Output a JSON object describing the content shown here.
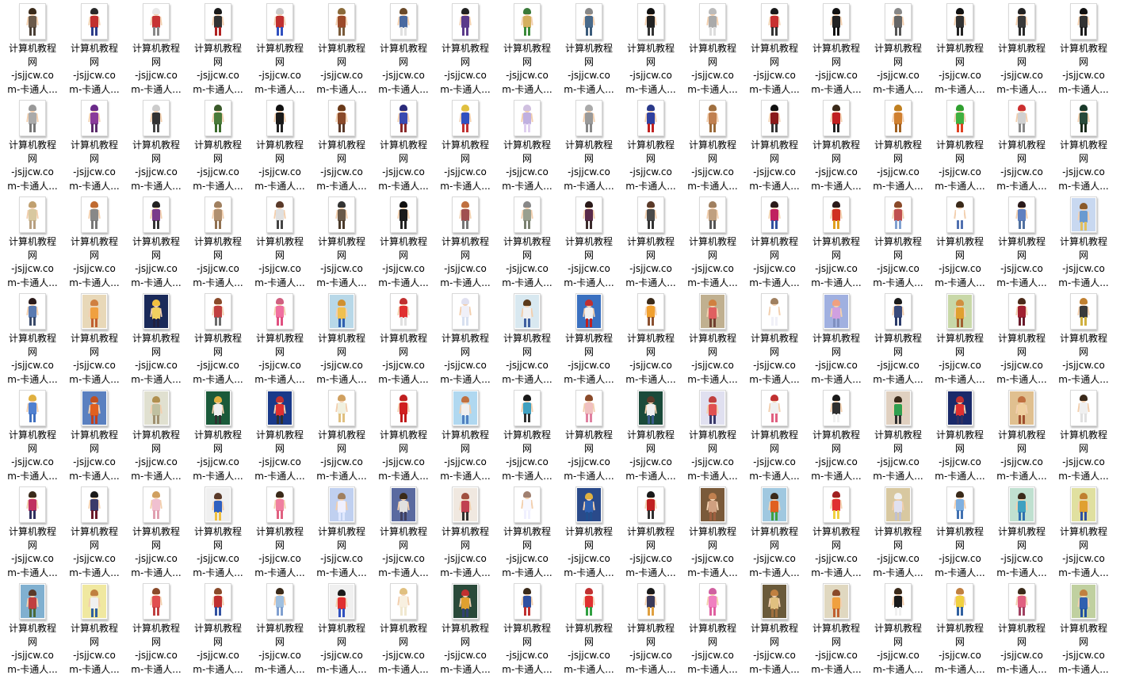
{
  "window": {
    "view": "Large icons",
    "content": "folder of cartoon character thumbnails"
  },
  "files": {
    "label_lines": [
      "计算机教程",
      "网",
      "-jsjjcw.co",
      "m-卡通人..."
    ],
    "columns": 18,
    "rows": 7,
    "items": [
      {
        "style": "char",
        "hair": "#3a2a1a",
        "top": "#6b5a4a",
        "bottom": "#4a3f35"
      },
      {
        "style": "char",
        "hair": "#2a2a2a",
        "top": "#c23030",
        "bottom": "#2d3d8a"
      },
      {
        "style": "char",
        "hair": "#e8e8e8",
        "top": "#c73434",
        "bottom": "#888888"
      },
      {
        "style": "char",
        "hair": "#1a1a1a",
        "top": "#333333",
        "bottom": "#b02020"
      },
      {
        "style": "char",
        "hair": "#cccccc",
        "top": "#c03030",
        "bottom": "#3050c0"
      },
      {
        "style": "char",
        "hair": "#8a6a3a",
        "top": "#9b4a2a",
        "bottom": "#7a5a3a"
      },
      {
        "style": "char",
        "hair": "#6a4a2a",
        "top": "#4a6aa0",
        "bottom": "#e0e0e0"
      },
      {
        "style": "char",
        "hair": "#222222",
        "top": "#5a3a8a",
        "bottom": "#5a3a8a"
      },
      {
        "style": "char",
        "hair": "#3a7a3a",
        "top": "#d4b060",
        "bottom": "#3a8a3a"
      },
      {
        "style": "char",
        "hair": "#888888",
        "top": "#4a6a8a",
        "bottom": "#3a5a7a"
      },
      {
        "style": "char",
        "hair": "#111111",
        "top": "#222222",
        "bottom": "#333333"
      },
      {
        "style": "char",
        "hair": "#bbbbbb",
        "top": "#aaaaaa",
        "bottom": "#dddddd"
      },
      {
        "style": "char",
        "hair": "#1a1a1a",
        "top": "#c83030",
        "bottom": "#333333"
      },
      {
        "style": "char",
        "hair": "#111111",
        "top": "#222222",
        "bottom": "#111111"
      },
      {
        "style": "char",
        "hair": "#888888",
        "top": "#666666",
        "bottom": "#555555"
      },
      {
        "style": "char",
        "hair": "#111111",
        "top": "#333333",
        "bottom": "#222222"
      },
      {
        "style": "char",
        "hair": "#222222",
        "top": "#3a3a3a",
        "bottom": "#2a2a2a"
      },
      {
        "style": "char",
        "hair": "#111111",
        "top": "#333333",
        "bottom": "#1a1a1a"
      },
      {
        "style": "char",
        "hair": "#999999",
        "top": "#aaaaaa",
        "bottom": "#777777"
      },
      {
        "style": "char",
        "hair": "#6a2a8a",
        "top": "#8a3a9a",
        "bottom": "#5a2a6a"
      },
      {
        "style": "char",
        "hair": "#cccccc",
        "top": "#333333",
        "bottom": "#444444"
      },
      {
        "style": "char",
        "hair": "#3a5a2a",
        "top": "#4a7a3a",
        "bottom": "#3a6a2a"
      },
      {
        "style": "char",
        "hair": "#111111",
        "top": "#1a1a1a",
        "bottom": "#222222"
      },
      {
        "style": "char",
        "hair": "#6a3a1a",
        "top": "#8a4a2a",
        "bottom": "#5a3a2a"
      },
      {
        "style": "char",
        "hair": "#2a2a7a",
        "top": "#3a4ab0",
        "bottom": "#8a2a2a"
      },
      {
        "style": "char",
        "hair": "#e0c040",
        "top": "#3050c0",
        "bottom": "#c03030"
      },
      {
        "style": "char",
        "hair": "#d0c0e0",
        "top": "#c0b0e0",
        "bottom": "#e0d0f0"
      },
      {
        "style": "char",
        "hair": "#aaaaaa",
        "top": "#999999",
        "bottom": "#888888"
      },
      {
        "style": "char",
        "hair": "#2a3a8a",
        "top": "#3040a0",
        "bottom": "#c02020"
      },
      {
        "style": "char",
        "hair": "#a07040",
        "top": "#c08050",
        "bottom": "#9a6a3a"
      },
      {
        "style": "char",
        "hair": "#111111",
        "top": "#8a1a1a",
        "bottom": "#333333"
      },
      {
        "style": "char",
        "hair": "#3a2a1a",
        "top": "#c02020",
        "bottom": "#222222"
      },
      {
        "style": "char",
        "hair": "#c08020",
        "top": "#d08030",
        "bottom": "#a06020"
      },
      {
        "style": "char",
        "hair": "#30a030",
        "top": "#40b040",
        "bottom": "#e04020"
      },
      {
        "style": "char",
        "hair": "#cc3030",
        "top": "#d0d0d0",
        "bottom": "#888888"
      },
      {
        "style": "char",
        "hair": "#1a3a2a",
        "top": "#2a4a3a",
        "bottom": "#1a2a1a"
      },
      {
        "style": "char",
        "hair": "#c0a070",
        "top": "#d8c8a0",
        "bottom": "#b8a080"
      },
      {
        "style": "char",
        "hair": "#c06a30",
        "top": "#888888",
        "bottom": "#777777"
      },
      {
        "style": "char",
        "hair": "#222222",
        "top": "#7a3a8a",
        "bottom": "#333333"
      },
      {
        "style": "char",
        "hair": "#a08060",
        "top": "#b09070",
        "bottom": "#907050"
      },
      {
        "style": "char",
        "hair": "#5a3a2a",
        "top": "#e0e0e0",
        "bottom": "#444444"
      },
      {
        "style": "char",
        "hair": "#333333",
        "top": "#6a5a4a",
        "bottom": "#4a3a2a"
      },
      {
        "style": "char",
        "hair": "#111111",
        "top": "#1a1a1a",
        "bottom": "#222222"
      },
      {
        "style": "char",
        "hair": "#c07040",
        "top": "#a05050",
        "bottom": "#777777"
      },
      {
        "style": "char",
        "hair": "#888888",
        "top": "#9aa090",
        "bottom": "#7a8070"
      },
      {
        "style": "char",
        "hair": "#2a1a1a",
        "top": "#5a2a4a",
        "bottom": "#3a2a2a"
      },
      {
        "style": "char",
        "hair": "#5a3a2a",
        "top": "#4a4a4a",
        "bottom": "#333333"
      },
      {
        "style": "char",
        "hair": "#a08060",
        "top": "#c0a080",
        "bottom": "#555555"
      },
      {
        "style": "char",
        "hair": "#2a1a1a",
        "top": "#c02060",
        "bottom": "#3050a0"
      },
      {
        "style": "char",
        "hair": "#2a1a1a",
        "top": "#d03020",
        "bottom": "#e0a020"
      },
      {
        "style": "char",
        "hair": "#8a4a2a",
        "top": "#c05050",
        "bottom": "#80a0d0"
      },
      {
        "style": "char",
        "hair": "#3a2a1a",
        "top": "#ffffff",
        "bottom": "#5070b0"
      },
      {
        "style": "char",
        "hair": "#2a1a1a",
        "top": "#6080c0",
        "bottom": "#5070a0"
      },
      {
        "style": "scene",
        "bg": "#c8d8f0",
        "hair": "#8a5a2a",
        "top": "#6a9ad0",
        "bottom": "#e0c060"
      },
      {
        "style": "char",
        "hair": "#2a1a1a",
        "top": "#5a7ab0",
        "bottom": "#3a4a6a"
      },
      {
        "style": "scene",
        "bg": "#e8d8b8",
        "hair": "#d08040",
        "top": "#f0a040",
        "bottom": "#c06030"
      },
      {
        "style": "scene",
        "bg": "#1a2a5a",
        "hair": "#f0c040",
        "top": "#f0d060",
        "bottom": "#202040"
      },
      {
        "style": "char",
        "hair": "#8a4a2a",
        "top": "#c04040",
        "bottom": "#6a6a6a"
      },
      {
        "style": "char",
        "hair": "#d06080",
        "top": "#f070a0",
        "bottom": "#e05080"
      },
      {
        "style": "scene",
        "bg": "#b8d8e8",
        "hair": "#d09030",
        "top": "#f0c050",
        "bottom": "#3060b0"
      },
      {
        "style": "char",
        "hair": "#c03030",
        "top": "#e03030",
        "bottom": "#e0e0e0"
      },
      {
        "style": "char",
        "hair": "#e0e0f0",
        "top": "#f0f0f8",
        "bottom": "#d8e0f0"
      },
      {
        "style": "scene",
        "bg": "#d8e8f0",
        "hair": "#5a3a1a",
        "top": "#f0f0f0",
        "bottom": "#4060a0"
      },
      {
        "style": "scene",
        "bg": "#3a70c0",
        "hair": "#c03030",
        "top": "#f0f0f0",
        "bottom": "#c02020"
      },
      {
        "style": "char",
        "hair": "#3a2a1a",
        "top": "#f0a030",
        "bottom": "#8a5030"
      },
      {
        "style": "scene",
        "bg": "#c0b090",
        "hair": "#d08040",
        "top": "#e06060",
        "bottom": "#704030"
      },
      {
        "style": "char",
        "hair": "#a08060",
        "top": "#ffffff",
        "bottom": "#f0f0f8"
      },
      {
        "style": "scene",
        "bg": "#a0b0e0",
        "hair": "#f0a080",
        "top": "#d0a0e0",
        "bottom": "#8090c0"
      },
      {
        "style": "char",
        "hair": "#1a1a1a",
        "top": "#3a4a7a",
        "bottom": "#2a3a6a"
      },
      {
        "style": "scene",
        "bg": "#c8d8a8",
        "hair": "#d09040",
        "top": "#e0a030",
        "bottom": "#a06030"
      },
      {
        "style": "char",
        "hair": "#4a2a1a",
        "top": "#a02030",
        "bottom": "#6a1a2a"
      },
      {
        "style": "char",
        "hair": "#c08030",
        "top": "#3a3a3a",
        "bottom": "#d0b040"
      },
      {
        "style": "char",
        "hair": "#e0b040",
        "top": "#5080d0",
        "bottom": "#4070c0"
      },
      {
        "style": "scene",
        "bg": "#5a80c0",
        "hair": "#c05020",
        "top": "#e06020",
        "bottom": "#c04020"
      },
      {
        "style": "scene",
        "bg": "#e0e0d0",
        "hair": "#b09050",
        "top": "#c0c0a0",
        "bottom": "#a09070"
      },
      {
        "style": "scene",
        "bg": "#1a5a3a",
        "hair": "#e0b040",
        "top": "#f0f0f0",
        "bottom": "#303030"
      },
      {
        "style": "scene",
        "bg": "#1a3a8a",
        "hair": "#c03030",
        "top": "#e03030",
        "bottom": "#303030"
      },
      {
        "style": "char",
        "hair": "#d0a060",
        "top": "#f0f0e0",
        "bottom": "#e0c080"
      },
      {
        "style": "char",
        "hair": "#c02020",
        "top": "#d02020",
        "bottom": "#c01818"
      },
      {
        "style": "scene",
        "bg": "#b0d8f0",
        "hair": "#c07040",
        "top": "#f0f0f0",
        "bottom": "#5080c0"
      },
      {
        "style": "char",
        "hair": "#1a1a1a",
        "top": "#40a0c0",
        "bottom": "#303030"
      },
      {
        "style": "char",
        "hair": "#8a4a2a",
        "top": "#f0c0c0",
        "bottom": "#e080a0"
      },
      {
        "style": "scene",
        "bg": "#1a4a3a",
        "hair": "#5a3a2a",
        "top": "#f0f0f0",
        "bottom": "#3a5a8a"
      },
      {
        "style": "scene",
        "bg": "#e0e0f0",
        "hair": "#c04040",
        "top": "#e05050",
        "bottom": "#3a3a6a"
      },
      {
        "style": "char",
        "hair": "#c03030",
        "top": "#f0f0f0",
        "bottom": "#e06080"
      },
      {
        "style": "char",
        "hair": "#1a1a1a",
        "top": "#303030",
        "bottom": "#f0f0f0"
      },
      {
        "style": "scene",
        "bg": "#e0d0c0",
        "hair": "#3a2a1a",
        "top": "#30a050",
        "bottom": "#303030"
      },
      {
        "style": "scene",
        "bg": "#1a2a6a",
        "hair": "#c03030",
        "top": "#e03030",
        "bottom": "#303060"
      },
      {
        "style": "scene",
        "bg": "#e0c090",
        "hair": "#c07040",
        "top": "#f0d0a0",
        "bottom": "#a05030"
      },
      {
        "style": "char",
        "hair": "#3a2a1a",
        "top": "#f0f0f0",
        "bottom": "#e0e0e0"
      },
      {
        "style": "char",
        "hair": "#3a2a1a",
        "top": "#c03060",
        "bottom": "#303060"
      },
      {
        "style": "char",
        "hair": "#1a1a1a",
        "top": "#3a3a6a",
        "bottom": "#6a1a2a"
      },
      {
        "style": "char",
        "hair": "#d0a060",
        "top": "#f0c0d0",
        "bottom": "#e0a0b0"
      },
      {
        "style": "scene",
        "bg": "#f0f0f0",
        "hair": "#5a3a2a",
        "top": "#3060c0",
        "bottom": "#f0c040"
      },
      {
        "style": "char",
        "hair": "#3a2a1a",
        "top": "#f080a0",
        "bottom": "#e06080"
      },
      {
        "style": "scene",
        "bg": "#c0d0f0",
        "hair": "#a08060",
        "top": "#f0f0ff",
        "bottom": "#e0e8ff"
      },
      {
        "style": "scene",
        "bg": "#5a6aa0",
        "hair": "#3a2a1a",
        "top": "#e0e0e0",
        "bottom": "#404060"
      },
      {
        "style": "scene",
        "bg": "#f0e8e0",
        "hair": "#a05040",
        "top": "#c04050",
        "bottom": "#303030"
      },
      {
        "style": "char",
        "hair": "#a08070",
        "top": "#f8f8ff",
        "bottom": "#f0f0ff"
      },
      {
        "style": "scene",
        "bg": "#2a4a8a",
        "hair": "#e0b040",
        "top": "#3060b0",
        "bottom": "#205090"
      },
      {
        "style": "char",
        "hair": "#1a1a1a",
        "top": "#c02020",
        "bottom": "#303030"
      },
      {
        "style": "scene",
        "bg": "#7a5a3a",
        "hair": "#c08050",
        "top": "#d0a080",
        "bottom": "#a06040"
      },
      {
        "style": "scene",
        "bg": "#a0c8e0",
        "hair": "#3a2a1a",
        "top": "#e06020",
        "bottom": "#40a040"
      },
      {
        "style": "char",
        "hair": "#a02020",
        "top": "#e03030",
        "bottom": "#f0d040"
      },
      {
        "style": "scene",
        "bg": "#d8c8a0",
        "hair": "#f0f0f0",
        "top": "#e0e0f0",
        "bottom": "#c0c0d0"
      },
      {
        "style": "char",
        "hair": "#3a2a1a",
        "top": "#80b0e0",
        "bottom": "#4070b0"
      },
      {
        "style": "scene",
        "bg": "#c0e0d0",
        "hair": "#3a2a1a",
        "top": "#40a0c0",
        "bottom": "#3070b0"
      },
      {
        "style": "scene",
        "bg": "#e0e0a0",
        "hair": "#c08030",
        "top": "#e0a030",
        "bottom": "#3050a0"
      },
      {
        "style": "scene",
        "bg": "#80b0d0",
        "hair": "#5a3a2a",
        "top": "#c04040",
        "bottom": "#4a6a3a"
      },
      {
        "style": "scene",
        "bg": "#f0e8a0",
        "hair": "#c08040",
        "top": "#f0f0f0",
        "bottom": "#3060a0"
      },
      {
        "style": "char",
        "hair": "#8a4a2a",
        "top": "#e05050",
        "bottom": "#c04040"
      },
      {
        "style": "char",
        "hair": "#8a4a2a",
        "top": "#c03030",
        "bottom": "#3050a0"
      },
      {
        "style": "char",
        "hair": "#3a2a1a",
        "top": "#a0c0e0",
        "bottom": "#80a0d0"
      },
      {
        "style": "scene",
        "bg": "#f0f0f0",
        "hair": "#1a1a1a",
        "top": "#e03030",
        "bottom": "#3050c0"
      },
      {
        "style": "char",
        "hair": "#e0c080",
        "top": "#f8f0e0",
        "bottom": "#f0e8d0"
      },
      {
        "style": "scene",
        "bg": "#2a4a3a",
        "hair": "#c03030",
        "top": "#e0a030",
        "bottom": "#304070"
      },
      {
        "style": "char",
        "hair": "#3a2a1a",
        "top": "#3050a0",
        "bottom": "#c03030"
      },
      {
        "style": "char",
        "hair": "#c03030",
        "top": "#e03030",
        "bottom": "#30a040"
      },
      {
        "style": "char",
        "hair": "#1a1a1a",
        "top": "#3a3a5a",
        "bottom": "#e0a040"
      },
      {
        "style": "char",
        "hair": "#d060a0",
        "top": "#f080c0",
        "bottom": "#e060a0"
      },
      {
        "style": "scene",
        "bg": "#6a5a3a",
        "hair": "#c08040",
        "top": "#e0c080",
        "bottom": "#a07040"
      },
      {
        "style": "scene",
        "bg": "#e0d8c0",
        "hair": "#8a4a2a",
        "top": "#f0a040",
        "bottom": "#c06030"
      },
      {
        "style": "char",
        "hair": "#3a2a1a",
        "top": "#1a1a1a",
        "bottom": "#f0f0f0"
      },
      {
        "style": "char",
        "hair": "#c08040",
        "top": "#f0d040",
        "bottom": "#3060a0"
      },
      {
        "style": "char",
        "hair": "#3a2a1a",
        "top": "#e06080",
        "bottom": "#a04060"
      },
      {
        "style": "scene",
        "bg": "#c0d0a0",
        "hair": "#c08040",
        "top": "#3060b0",
        "bottom": "#2050a0"
      }
    ]
  }
}
